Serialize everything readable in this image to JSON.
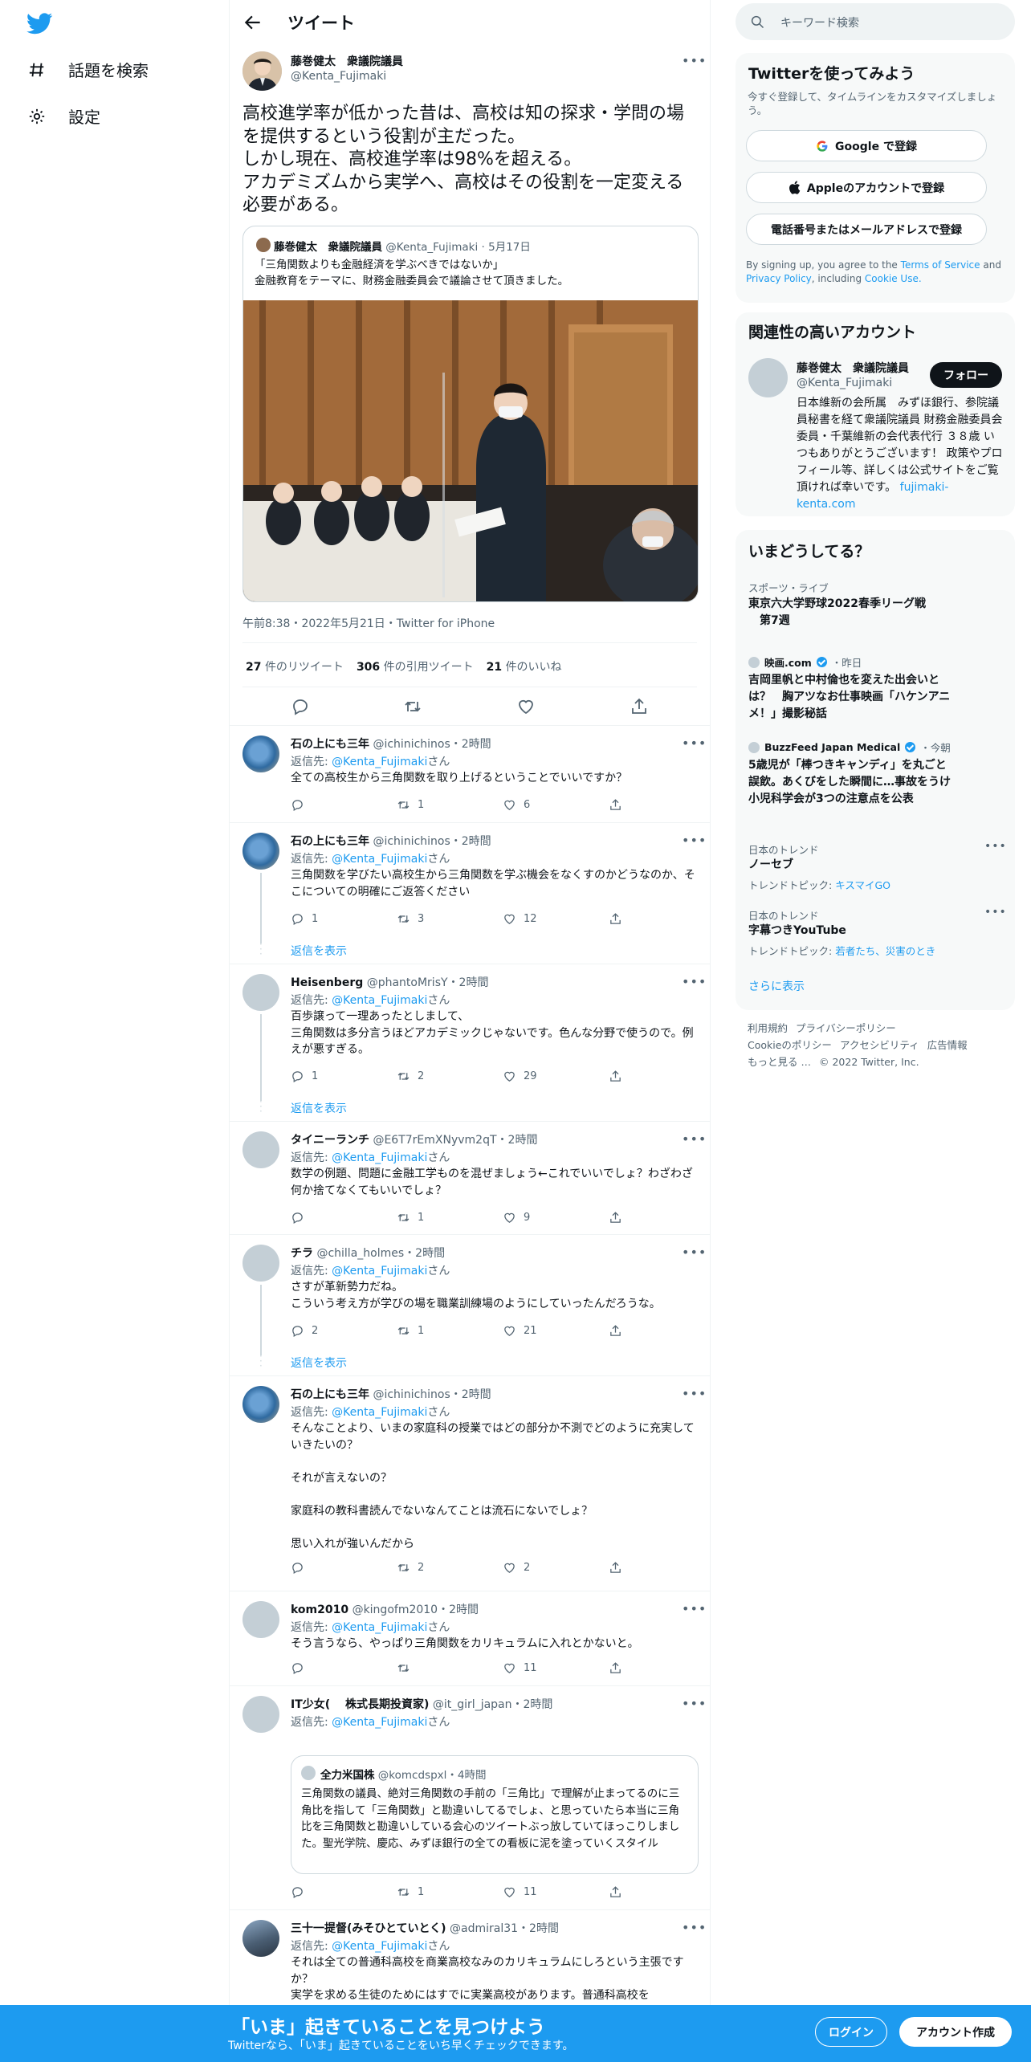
{
  "nav": {
    "items": [
      {
        "icon": "hashtag-icon",
        "label": "話題を検索"
      },
      {
        "icon": "gear-icon",
        "label": "設定"
      }
    ]
  },
  "header": {
    "title": "ツイート"
  },
  "post": {
    "author_name": "藤巻健太　衆議院議員",
    "author_handle": "@Kenta_Fujimaki",
    "text": "高校進学率が低かった昔は、高校は知の探求・学問の場を提供するという役割が主だった。\nしかし現在、高校進学率は98%を超える。\nアカデミズムから実学へ、高校はその役割を一定変える必要がある。",
    "quote": {
      "author_name": "藤巻健太　衆議院議員",
      "author_handle": "@Kenta_Fujimaki",
      "date": "5月17日",
      "text": "「三角関数よりも金融経済を学ぶべきではないか」\n金融教育をテーマに、財務金融委員会で議論させて頂きました。"
    },
    "timestamp": "午前8:38・2022年5月21日・Twitter for iPhone",
    "stats": {
      "retweets": "27",
      "retweets_label": "件のリツイート",
      "quotes": "306",
      "quotes_label": "件の引用ツイート",
      "likes": "21",
      "likes_label": "件のいいね"
    }
  },
  "reply_to_label": "返信先:",
  "reply_to_handle": "@Kenta_Fujimaki",
  "reply_to_suffix": "さん",
  "show_thread_label": "返信を表示",
  "replies": [
    {
      "name": "石の上にも三年",
      "handle": "@ichinichinos",
      "time": "2時間",
      "text": "全ての高校生から三角関数を取り上げるということでいいですか？",
      "replies": "",
      "retweets": "1",
      "likes": "6"
    },
    {
      "name": "石の上にも三年",
      "handle": "@ichinichinos",
      "time": "2時間",
      "text": "三角関数を学びたい高校生から三角関数を学ぶ機会をなくすのかどうなのか、そこについての明確にご返答ください",
      "replies": "1",
      "retweets": "3",
      "likes": "12"
    },
    {
      "name": "Heisenberg",
      "handle": "@phantoMrisY",
      "time": "2時間",
      "text": "百歩譲って一理あったとしまして、\n三角関数は多分言うほどアカデミックじゃないです。色んな分野で使うので。例えが悪すぎる。",
      "replies": "1",
      "retweets": "2",
      "likes": "29"
    },
    {
      "name": "タイニーランチ",
      "handle": "@E6T7rEmXNyvm2qT",
      "time": "2時間",
      "text": "数学の例題、問題に金融工学ものを混ぜましょう←これでいいでしょ？わざわざ何か捨てなくてもいいでしょ？",
      "replies": "",
      "retweets": "1",
      "likes": "9"
    },
    {
      "name": "チラ",
      "handle": "@chilla_holmes",
      "time": "2時間",
      "text": "さすが革新勢力だね。\nこういう考え方が学びの場を職業訓練場のようにしていったんだろうな。",
      "replies": "2",
      "retweets": "1",
      "likes": "21"
    },
    {
      "name": "石の上にも三年",
      "handle": "@ichinichinos",
      "time": "2時間",
      "text": "そんなことより、いまの家庭科の授業ではどの部分か不測でどのように充実していきたいの？\n\nそれが言えないの？\n\n家庭科の教科書読んでないなんてことは流石にないでしょ？\n\n思い入れが強いんだから",
      "replies": "",
      "retweets": "2",
      "likes": "2"
    },
    {
      "name": "kom2010",
      "handle": "@kingofm2010",
      "time": "2時間",
      "text": "そう言うなら、やっぱり三角関数をカリキュラムに入れとかないと。",
      "replies": "",
      "retweets": "",
      "likes": "11"
    },
    {
      "name": "IT少女(　 株式長期投資家)",
      "handle": "@it_girl_japan",
      "time": "2時間",
      "text": "",
      "replies": "",
      "retweets": "1",
      "likes": "11",
      "embed": {
        "name": "全力米国株",
        "handle": "@komcdspxl",
        "time": "4時間",
        "text": "三角関数の議員、絶対三角関数の手前の「三角比」で理解が止まってるのに三角比を指して「三角関数」と勘違いしてるでしょ、と思っていたら本当に三角比を三角関数と勘違いしている会心のツイートぶっ放していてほっこりしました。聖光学院、慶応、みずほ銀行の全ての看板に泥を塗っていくスタイル"
      }
    },
    {
      "name": "三十一提督(みそひとていとく)",
      "handle": "@admiral31",
      "time": "2時間",
      "text": "それは全ての普通科高校を商業高校なみのカリキュラムにしろという主張ですか？\n実学を求める生徒のためにはすでに実業高校があります。普通科高校を",
      "replies": "",
      "retweets": "",
      "likes": ""
    }
  ],
  "search": {
    "placeholder": "キーワード検索"
  },
  "signup": {
    "title": "Twitterを使ってみよう",
    "subtitle": "今すぐ登録して、タイムラインをカスタマイズしましょう。",
    "google": "Google で登録",
    "apple": "Appleのアカウントで登録",
    "phone": "電話番号またはメールアドレスで登録",
    "terms_prefix": "By signing up, you agree to the",
    "terms_link": "Terms of Service",
    "terms_and": "and",
    "privacy_link": "Privacy Policy",
    "terms_including": ", including",
    "cookie_link": "Cookie Use."
  },
  "related": {
    "title": "関連性の高いアカウント",
    "name": "藤巻健太　衆議院議員",
    "handle": "@Kenta_Fujimaki",
    "follow": "フォロー",
    "bio": "日本維新の会所属　みずほ銀行、参院議員秘書を経て衆議院議員 財務金融委員会委員・千葉維新の会代表代行 ３８歳 いつもありがとうございます！ 政策やプロフィール等、詳しくは公式サイトをご覧頂ければ幸いです。",
    "bio_link": "fujimaki-kenta.com"
  },
  "trends": {
    "title": "いまどうしてる？",
    "items": [
      {
        "context": "スポーツ・ライブ",
        "title": "東京六大学野球2022春季リーグ戦\n　第7週"
      },
      {
        "context_name": "映画.com",
        "context_time": "・昨日",
        "title": "吉岡里帆と中村倫也を変えた出会いとは？　胸アツなお仕事映画「ハケンアニメ！」撮影秘話"
      },
      {
        "context_name": "BuzzFeed Japan Medical",
        "context_time": "・今朝",
        "title": "5歳児が「棒つきキャンディ」を丸ごと誤飲。あくびをした瞬間に…事故をうけ小児科学会が3つの注意点を公表"
      },
      {
        "context": "日本のトレンド",
        "title": "ノーセブ",
        "sub_label": "トレンドトピック:",
        "sub_value": "キスマイGO"
      },
      {
        "context": "日本のトレンド",
        "title": "字幕つきYouTube",
        "sub_label": "トレンドトピック:",
        "sub_value": "若者たち、災害のとき"
      }
    ],
    "show_more": "さらに表示"
  },
  "footer": {
    "links": [
      "利用規約",
      "プライバシーポリシー",
      "Cookieのポリシー",
      "アクセシビリティ",
      "広告情報",
      "もっと見る …",
      "© 2022 Twitter, Inc."
    ]
  },
  "bottom_bar": {
    "title": "「いま」起きていることを見つけよう",
    "subtitle": "Twitterなら、「いま」起きていることをいち早くチェックできます。",
    "login": "ログイン",
    "signup": "アカウント作成"
  },
  "colors": {
    "accent": "#1d9bf0",
    "text": "#0f1419",
    "muted": "#536471",
    "border": "#eff3f4"
  }
}
